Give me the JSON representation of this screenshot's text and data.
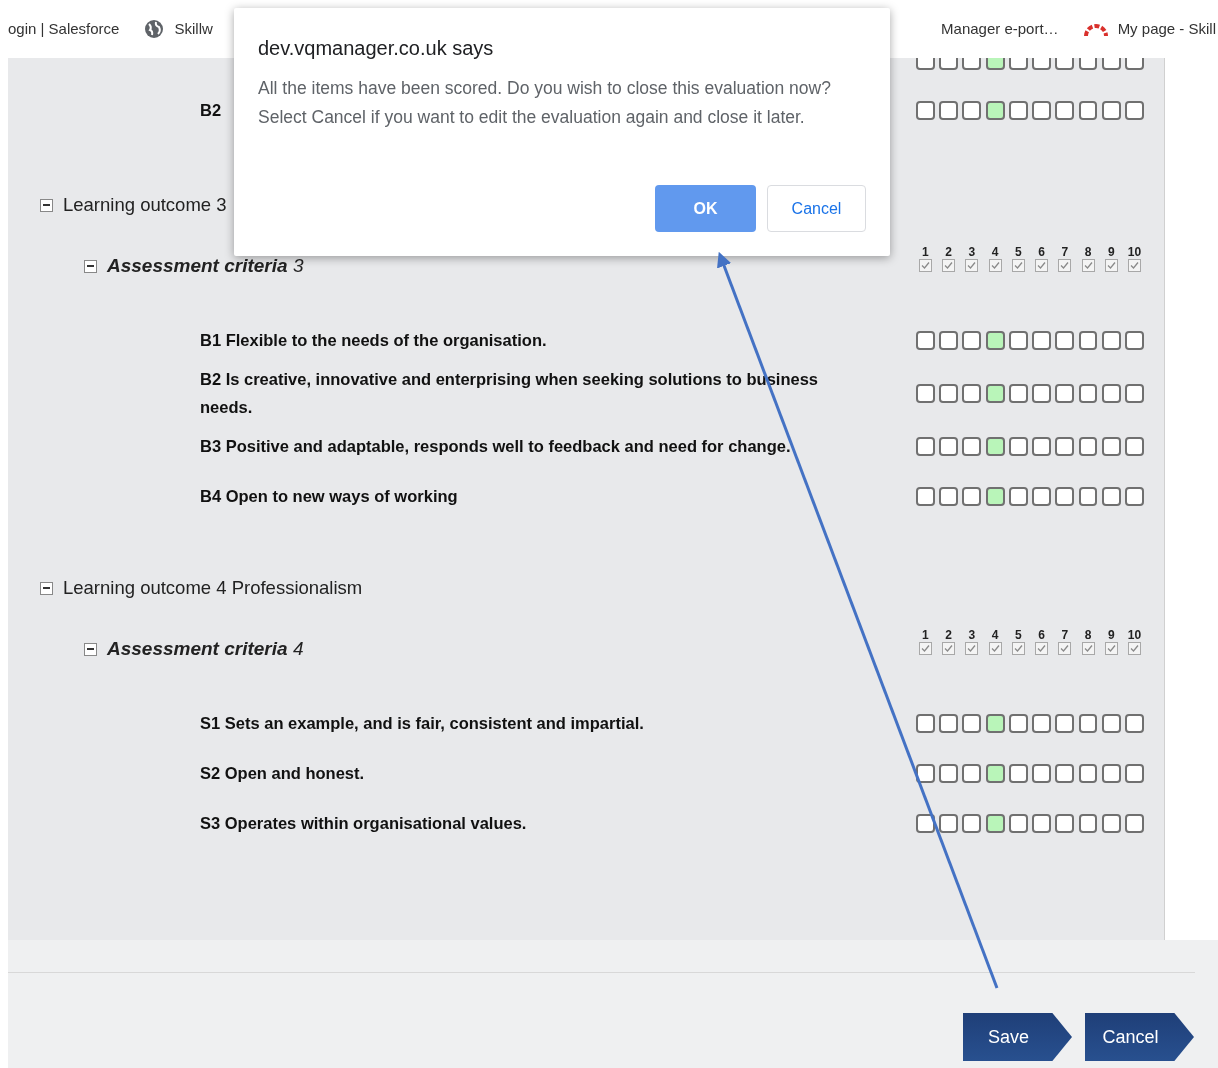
{
  "bookmarks": [
    {
      "label": "ogin | Salesforce",
      "kind": "plain"
    },
    {
      "label": "Skillw",
      "kind": "globe"
    },
    {
      "label": "Manager e-port…",
      "kind": "plain"
    },
    {
      "label": "My page - Skill",
      "kind": "arc"
    }
  ],
  "top_criteria": [
    {
      "scale": [
        {
          "selected": false
        },
        {
          "selected": false
        },
        {
          "selected": false
        },
        {
          "selected": true
        },
        {
          "selected": false
        },
        {
          "selected": false
        },
        {
          "selected": false
        },
        {
          "selected": false
        },
        {
          "selected": false
        },
        {
          "selected": false
        }
      ]
    },
    {
      "label": "B2",
      "scale": [
        {
          "selected": false
        },
        {
          "selected": false
        },
        {
          "selected": false
        },
        {
          "selected": true
        },
        {
          "selected": false
        },
        {
          "selected": false
        },
        {
          "selected": false
        },
        {
          "selected": false
        },
        {
          "selected": false
        },
        {
          "selected": false
        }
      ]
    }
  ],
  "outcomes": [
    {
      "title": "Learning outcome 3",
      "expanded": true,
      "criteria_title": "**Assessment criteria** 3",
      "criteria_expanded": true,
      "scale_header": [
        {
          "label": "1",
          "checked": true
        },
        {
          "label": "2",
          "checked": true
        },
        {
          "label": "3",
          "checked": true
        },
        {
          "label": "4",
          "checked": true
        },
        {
          "label": "5",
          "checked": true
        },
        {
          "label": "6",
          "checked": true
        },
        {
          "label": "7",
          "checked": true
        },
        {
          "label": "8",
          "checked": true
        },
        {
          "label": "9",
          "checked": true
        },
        {
          "label": "10",
          "checked": true
        }
      ],
      "items": [
        {
          "label": "B1 Flexible to the needs of the organisation.",
          "scale": [
            {
              "selected": false
            },
            {
              "selected": false
            },
            {
              "selected": false
            },
            {
              "selected": true
            },
            {
              "selected": false
            },
            {
              "selected": false
            },
            {
              "selected": false
            },
            {
              "selected": false
            },
            {
              "selected": false
            },
            {
              "selected": false
            }
          ]
        },
        {
          "label": "B2 Is creative, innovative and enterprising when seeking solutions to business needs.",
          "scale": [
            {
              "selected": false
            },
            {
              "selected": false
            },
            {
              "selected": false
            },
            {
              "selected": true
            },
            {
              "selected": false
            },
            {
              "selected": false
            },
            {
              "selected": false
            },
            {
              "selected": false
            },
            {
              "selected": false
            },
            {
              "selected": false
            }
          ]
        },
        {
          "label": "B3 Positive and adaptable, responds well to feedback and need for change.",
          "scale": [
            {
              "selected": false
            },
            {
              "selected": false
            },
            {
              "selected": false
            },
            {
              "selected": true
            },
            {
              "selected": false
            },
            {
              "selected": false
            },
            {
              "selected": false
            },
            {
              "selected": false
            },
            {
              "selected": false
            },
            {
              "selected": false
            }
          ]
        },
        {
          "label": "B4 Open to new ways of working",
          "scale": [
            {
              "selected": false
            },
            {
              "selected": false
            },
            {
              "selected": false
            },
            {
              "selected": true
            },
            {
              "selected": false
            },
            {
              "selected": false
            },
            {
              "selected": false
            },
            {
              "selected": false
            },
            {
              "selected": false
            },
            {
              "selected": false
            }
          ]
        }
      ]
    },
    {
      "title": "Learning outcome 4 Professionalism",
      "expanded": true,
      "criteria_title": "**Assessment criteria** 4",
      "criteria_expanded": true,
      "scale_header": [
        {
          "label": "1",
          "checked": true
        },
        {
          "label": "2",
          "checked": true
        },
        {
          "label": "3",
          "checked": true
        },
        {
          "label": "4",
          "checked": true
        },
        {
          "label": "5",
          "checked": true
        },
        {
          "label": "6",
          "checked": true
        },
        {
          "label": "7",
          "checked": true
        },
        {
          "label": "8",
          "checked": true
        },
        {
          "label": "9",
          "checked": true
        },
        {
          "label": "10",
          "checked": true
        }
      ],
      "items": [
        {
          "label": "S1 Sets an example, and is fair, consistent and impartial.",
          "scale": [
            {
              "selected": false
            },
            {
              "selected": false
            },
            {
              "selected": false
            },
            {
              "selected": true
            },
            {
              "selected": false
            },
            {
              "selected": false
            },
            {
              "selected": false
            },
            {
              "selected": false
            },
            {
              "selected": false
            },
            {
              "selected": false
            }
          ]
        },
        {
          "label": "S2 Open and honest.",
          "scale": [
            {
              "selected": false
            },
            {
              "selected": false
            },
            {
              "selected": false
            },
            {
              "selected": true
            },
            {
              "selected": false
            },
            {
              "selected": false
            },
            {
              "selected": false
            },
            {
              "selected": false
            },
            {
              "selected": false
            },
            {
              "selected": false
            }
          ]
        },
        {
          "label": "S3 Operates within organisational values.",
          "scale": [
            {
              "selected": false
            },
            {
              "selected": false
            },
            {
              "selected": false
            },
            {
              "selected": true
            },
            {
              "selected": false
            },
            {
              "selected": false
            },
            {
              "selected": false
            },
            {
              "selected": false
            },
            {
              "selected": false
            },
            {
              "selected": false
            }
          ]
        }
      ]
    }
  ],
  "footer_buttons": [
    "Save",
    "Cancel"
  ],
  "dialog": {
    "title": "dev.vqmanager.co.uk says",
    "message": "All the items have been scored. Do you wish to close this evaluation now? Select Cancel if you want to edit the evaluation again and close it later.",
    "buttons": [
      {
        "label": "OK",
        "kind": "primary"
      },
      {
        "label": "Cancel",
        "kind": "secondary"
      }
    ]
  }
}
